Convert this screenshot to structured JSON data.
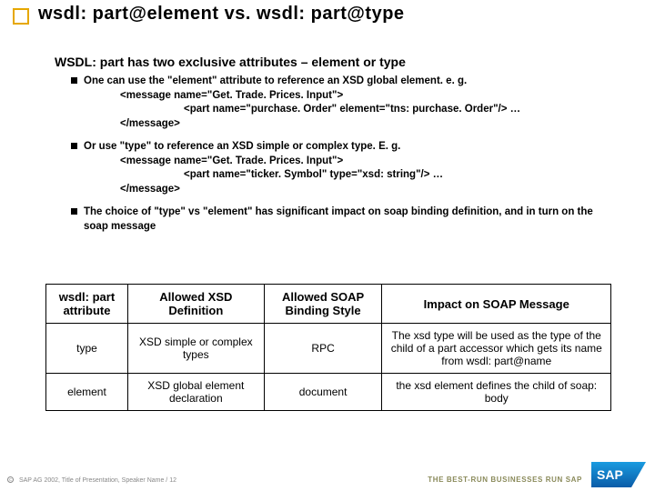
{
  "title": "wsdl: part@element vs. wsdl: part@type",
  "subheading": "WSDL: part has two exclusive attributes – element or type",
  "bullets": [
    {
      "lead": "One can use the \"element\" attribute to reference an XSD global element. e. g.",
      "lines": [
        "<message name=\"Get. Trade. Prices. Input\">",
        "        <part name=\"purchase. Order\" element=\"tns: purchase. Order\"/> …",
        "</message>"
      ]
    },
    {
      "lead": "Or use \"type\" to reference an XSD simple or complex type. E. g.",
      "lines": [
        "<message name=\"Get. Trade. Prices. Input\">",
        "        <part name=\"ticker. Symbol\" type=\"xsd: string\"/> …",
        "</message>"
      ]
    },
    {
      "lead": "The choice of \"type\" vs \"element\" has significant impact on soap binding definition, and in turn on the soap message",
      "lines": []
    }
  ],
  "table": {
    "headers": [
      "wsdl: part attribute",
      "Allowed XSD Definition",
      "Allowed SOAP Binding Style",
      "Impact on SOAP Message"
    ],
    "rows": [
      [
        "type",
        "XSD simple or complex types",
        "RPC",
        "The xsd type will be used as the type of the child of a part accessor which gets its name from wsdl: part@name"
      ],
      [
        "element",
        "XSD global element declaration",
        "document",
        "the xsd element defines the child of soap: body"
      ]
    ]
  },
  "footer": "SAP AG 2002, Title of Presentation, Speaker Name / 12",
  "tagline": "THE BEST-RUN BUSINESSES RUN SAP",
  "logo": "SAP"
}
